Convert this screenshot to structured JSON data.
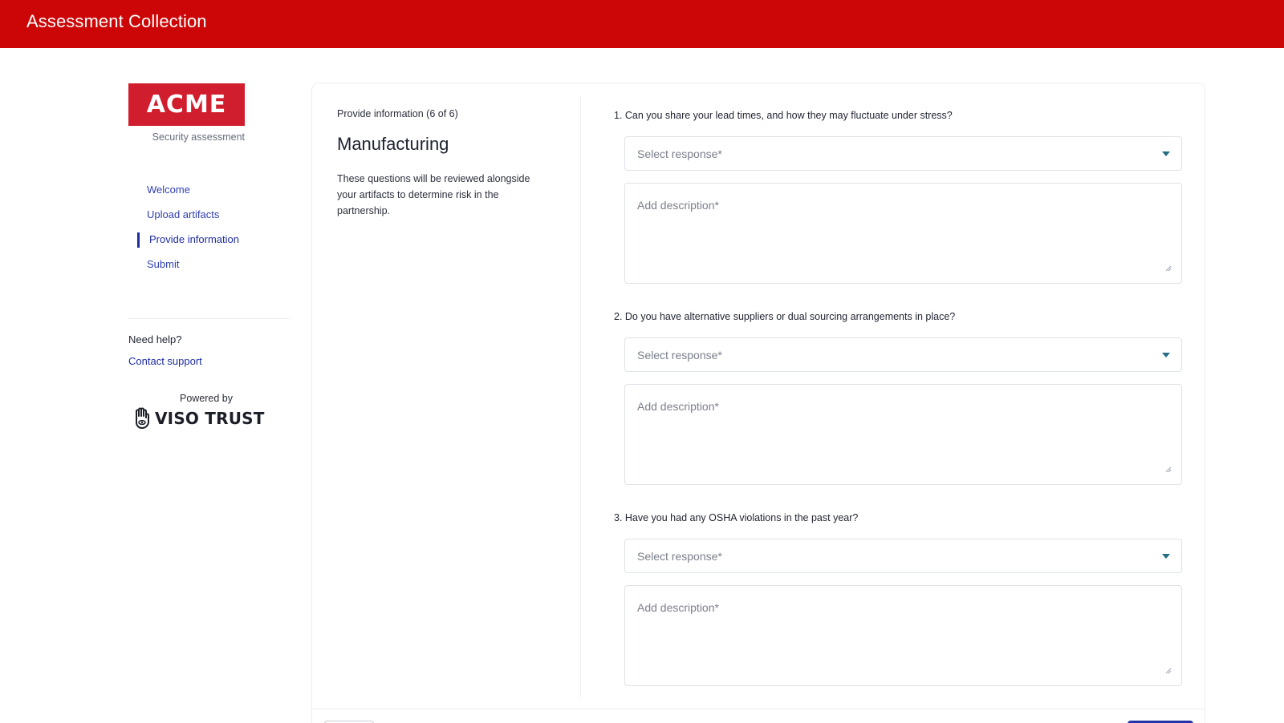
{
  "header": {
    "title": "Assessment Collection"
  },
  "brand": {
    "logo_text": "ACME",
    "subtitle": "Security assessment"
  },
  "nav": {
    "items": [
      {
        "label": "Welcome"
      },
      {
        "label": "Upload artifacts"
      },
      {
        "label": "Provide information",
        "active": true
      },
      {
        "label": "Submit"
      }
    ]
  },
  "help": {
    "title": "Need help?",
    "link": "Contact support"
  },
  "powered_by": {
    "label": "Powered by",
    "brand": "VISO TRUST"
  },
  "section": {
    "step": "Provide information (6 of 6)",
    "title": "Manufacturing",
    "description": "These questions will be reviewed alongside your artifacts to determine risk in the partnership."
  },
  "questions": [
    {
      "label": "1. Can you share your lead times, and how they may fluctuate under stress?",
      "select_placeholder": "Select response*",
      "description_placeholder": "Add description*"
    },
    {
      "label": "2. Do you have alternative suppliers or dual sourcing arrangements in place?",
      "select_placeholder": "Select response*",
      "description_placeholder": "Add description*"
    },
    {
      "label": "3. Have you had any OSHA violations in the past year?",
      "select_placeholder": "Select response*",
      "description_placeholder": "Add description*"
    }
  ],
  "colors": {
    "header_bg": "#cc0606",
    "brand_red": "#d01e2e",
    "link_blue": "#1f2ea3",
    "caret_teal": "#246d83"
  }
}
